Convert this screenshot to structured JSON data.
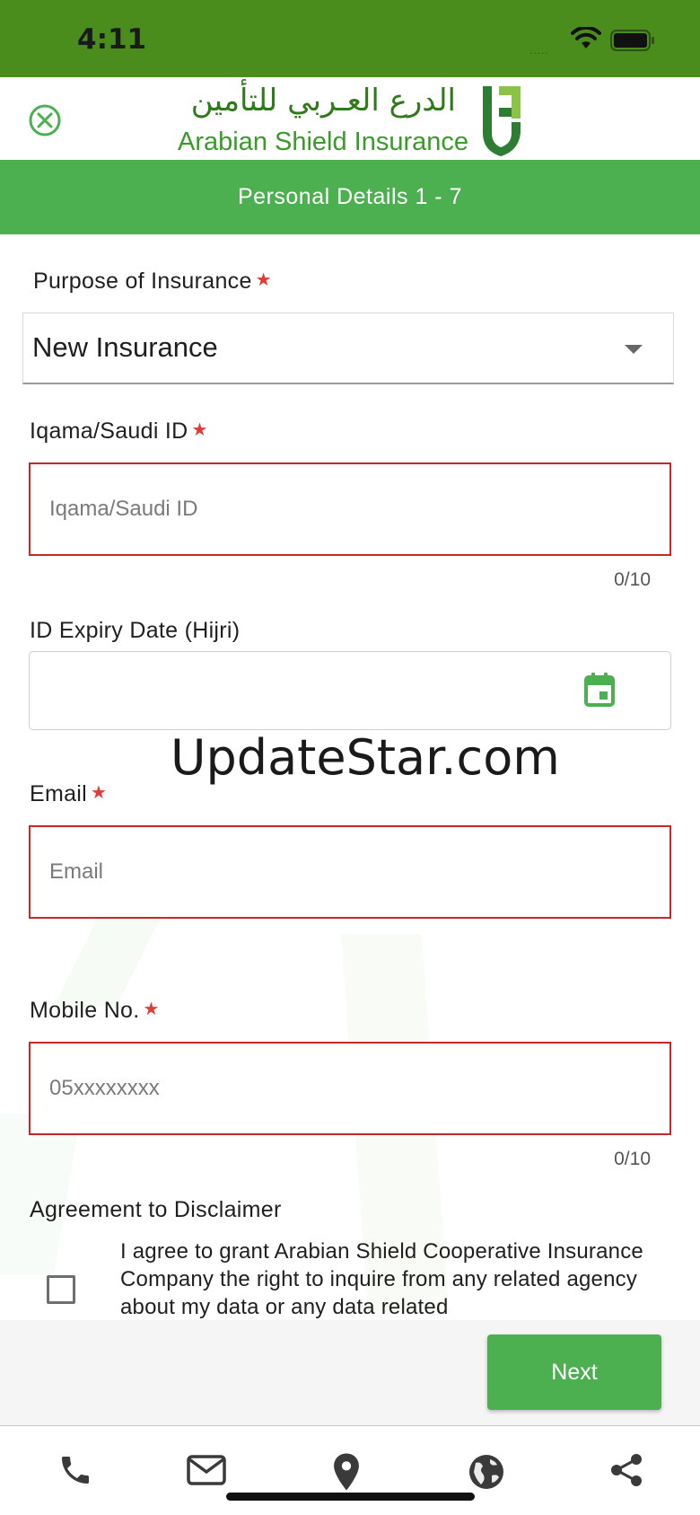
{
  "status_bar": {
    "time": "4:11",
    "signal_dots": "....."
  },
  "header": {
    "logo_arabic": "الدرع العـربي للتأمين",
    "logo_english": "Arabian Shield Insurance"
  },
  "step_bar": {
    "title": "Personal Details  1  -  7"
  },
  "form": {
    "purpose": {
      "label": "Purpose of Insurance",
      "value": "New Insurance",
      "required_mark": "★"
    },
    "iqama": {
      "label": "Iqama/Saudi ID",
      "placeholder": "Iqama/Saudi ID",
      "counter": "0/10",
      "required_mark": "★"
    },
    "expiry": {
      "label": "ID Expiry Date (Hijri)"
    },
    "email": {
      "label": "Email",
      "placeholder": "Email",
      "required_mark": "★"
    },
    "mobile": {
      "label": "Mobile No.",
      "placeholder": "05xxxxxxxx",
      "counter": "0/10",
      "required_mark": "★"
    },
    "disclaimer": {
      "label": "Agreement to Disclaimer",
      "text": "I agree to grant Arabian Shield Cooperative Insurance Company the right to inquire from any related agency about my data or any data related"
    }
  },
  "watermark": "UpdateStar.com",
  "actions": {
    "next_label": "Next"
  },
  "nav": {
    "items": [
      "phone-icon",
      "mail-icon",
      "location-icon",
      "globe-icon",
      "share-icon"
    ]
  },
  "colors": {
    "status_bar": "#4a8d1c",
    "brand_green": "#4caf50",
    "error_red": "#c62828",
    "required_star": "#e53935"
  }
}
